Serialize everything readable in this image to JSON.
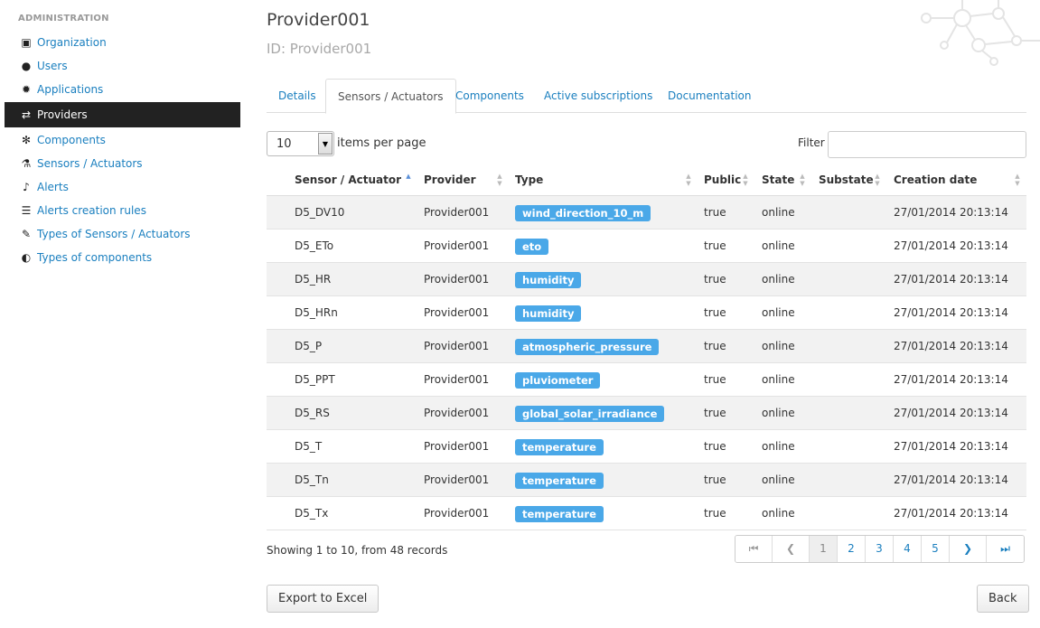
{
  "sidebar": {
    "header": "ADMINISTRATION",
    "items": [
      {
        "label": "Organization",
        "icon": "briefcase-icon",
        "glyph": "▣"
      },
      {
        "label": "Users",
        "icon": "user-icon",
        "glyph": "●"
      },
      {
        "label": "Applications",
        "icon": "gear-icon",
        "glyph": "✹"
      },
      {
        "label": "Providers",
        "icon": "exchange-icon",
        "glyph": "⇄"
      },
      {
        "label": "Components",
        "icon": "gears-icon",
        "glyph": "✻"
      },
      {
        "label": "Sensors / Actuators",
        "icon": "flask-icon",
        "glyph": "⚗"
      },
      {
        "label": "Alerts",
        "icon": "bell-icon",
        "glyph": "♪"
      },
      {
        "label": "Alerts creation rules",
        "icon": "list-icon",
        "glyph": "☰"
      },
      {
        "label": "Types of Sensors / Actuators",
        "icon": "wrench-icon",
        "glyph": "✎"
      },
      {
        "label": "Types of components",
        "icon": "contrast-icon",
        "glyph": "◐"
      }
    ]
  },
  "page": {
    "title": "Provider001",
    "subtitle": "ID: Provider001"
  },
  "tabs": [
    "Details",
    "Sensors / Actuators",
    "Components",
    "Active subscriptions",
    "Documentation"
  ],
  "table_controls": {
    "per_page_value": "10",
    "per_page_label": "items per page",
    "filter_label": "Filter",
    "filter_value": ""
  },
  "table": {
    "headers": [
      "Sensor / Actuator",
      "Provider",
      "Type",
      "Public",
      "State",
      "Substate",
      "Creation date"
    ],
    "rows": [
      {
        "sensor": "D5_DV10",
        "provider": "Provider001",
        "type": "wind_direction_10_m",
        "public": "true",
        "state": "online",
        "substate": "",
        "created": "27/01/2014 20:13:14"
      },
      {
        "sensor": "D5_ETo",
        "provider": "Provider001",
        "type": "eto",
        "public": "true",
        "state": "online",
        "substate": "",
        "created": "27/01/2014 20:13:14"
      },
      {
        "sensor": "D5_HR",
        "provider": "Provider001",
        "type": "humidity",
        "public": "true",
        "state": "online",
        "substate": "",
        "created": "27/01/2014 20:13:14"
      },
      {
        "sensor": "D5_HRn",
        "provider": "Provider001",
        "type": "humidity",
        "public": "true",
        "state": "online",
        "substate": "",
        "created": "27/01/2014 20:13:14"
      },
      {
        "sensor": "D5_P",
        "provider": "Provider001",
        "type": "atmospheric_pressure",
        "public": "true",
        "state": "online",
        "substate": "",
        "created": "27/01/2014 20:13:14"
      },
      {
        "sensor": "D5_PPT",
        "provider": "Provider001",
        "type": "pluviometer",
        "public": "true",
        "state": "online",
        "substate": "",
        "created": "27/01/2014 20:13:14"
      },
      {
        "sensor": "D5_RS",
        "provider": "Provider001",
        "type": "global_solar_irradiance",
        "public": "true",
        "state": "online",
        "substate": "",
        "created": "27/01/2014 20:13:14"
      },
      {
        "sensor": "D5_T",
        "provider": "Provider001",
        "type": "temperature",
        "public": "true",
        "state": "online",
        "substate": "",
        "created": "27/01/2014 20:13:14"
      },
      {
        "sensor": "D5_Tn",
        "provider": "Provider001",
        "type": "temperature",
        "public": "true",
        "state": "online",
        "substate": "",
        "created": "27/01/2014 20:13:14"
      },
      {
        "sensor": "D5_Tx",
        "provider": "Provider001",
        "type": "temperature",
        "public": "true",
        "state": "online",
        "substate": "",
        "created": "27/01/2014 20:13:14"
      }
    ]
  },
  "footer": {
    "showing": "Showing 1 to 10, from 48 records",
    "pagination": [
      "⏮",
      "❮",
      "1",
      "2",
      "3",
      "4",
      "5",
      "❯",
      "⏭"
    ],
    "export_label": "Export to Excel",
    "back_label": "Back"
  },
  "colors": {
    "accent": "#1a7fbf",
    "tag": "#4aa8e8",
    "sidebar_active": "#222222"
  }
}
